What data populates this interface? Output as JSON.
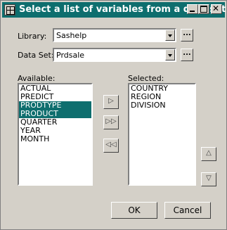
{
  "window": {
    "title": "Select a list of variables from a data set",
    "controls": {
      "minimize_icon": "minimize-icon",
      "maximize_icon": "maximize-icon",
      "close_icon": "close-icon"
    }
  },
  "library": {
    "label": "Library:",
    "value": "Sashelp",
    "browse_label": "..."
  },
  "dataset": {
    "label": "Data Set:",
    "value": "Prdsale",
    "browse_label": "..."
  },
  "available": {
    "label": "Available:",
    "items": [
      {
        "text": "ACTUAL",
        "selected": false
      },
      {
        "text": "PREDICT",
        "selected": false
      },
      {
        "text": "PRODTYPE",
        "selected": true
      },
      {
        "text": "PRODUCT",
        "selected": true
      },
      {
        "text": "QUARTER",
        "selected": false
      },
      {
        "text": "YEAR",
        "selected": false
      },
      {
        "text": "MONTH",
        "selected": false
      }
    ]
  },
  "selected": {
    "label": "Selected:",
    "items": [
      {
        "text": "COUNTRY"
      },
      {
        "text": "REGION"
      },
      {
        "text": "DIVISION"
      }
    ]
  },
  "move_buttons": [
    {
      "name": "move-right-button",
      "glyph": "▷",
      "icon": "arrow-right-icon"
    },
    {
      "name": "move-all-right-button",
      "glyph": "▷▷",
      "icon": "double-arrow-right-icon"
    },
    {
      "name": "move-all-left-button",
      "glyph": "◁◁",
      "icon": "double-arrow-left-icon"
    }
  ],
  "order_buttons": [
    {
      "name": "move-up-button",
      "glyph": "△",
      "icon": "arrow-up-icon"
    },
    {
      "name": "move-down-button",
      "glyph": "▽",
      "icon": "arrow-down-icon"
    }
  ],
  "buttons": {
    "ok": "OK",
    "cancel": "Cancel"
  },
  "colors": {
    "titlebar": "#0e6e6e",
    "selection": "#0e6e6e",
    "face": "#d4d0c8"
  }
}
